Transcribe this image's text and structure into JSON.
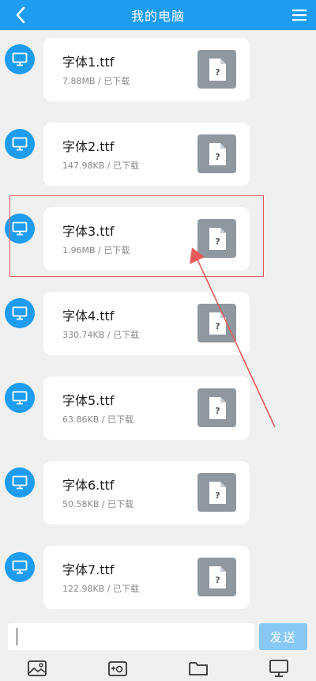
{
  "header": {
    "title": "我的电脑",
    "back_icon": "chevron-left-icon",
    "menu_icon": "hamburger-menu-icon"
  },
  "messages": [
    {
      "name": "字体1.ttf",
      "meta": "7.88MB / 已下载"
    },
    {
      "name": "字体2.ttf",
      "meta": "147.98KB / 已下载"
    },
    {
      "name": "字体3.ttf",
      "meta": "1.96MB / 已下载"
    },
    {
      "name": "字体4.ttf",
      "meta": "330.74KB / 已下载"
    },
    {
      "name": "字体5.ttf",
      "meta": "63.86KB / 已下载"
    },
    {
      "name": "字体6.ttf",
      "meta": "50.58KB / 已下载"
    },
    {
      "name": "字体7.ttf",
      "meta": "122.98KB / 已下载"
    }
  ],
  "input": {
    "placeholder": "",
    "send_label": "发送"
  },
  "toolbar": [
    {
      "icon": "image-icon"
    },
    {
      "icon": "camera-icon"
    },
    {
      "icon": "folder-icon"
    },
    {
      "icon": "monitor-icon"
    }
  ],
  "colors": {
    "header_bg": "#1e9cf0",
    "avatar_bg": "#1e9cf0",
    "send_button_bg": "#88c8f5",
    "file_icon_bg": "#8f979f",
    "annotation": "#e85a5a",
    "background": "#f0f0f0"
  }
}
